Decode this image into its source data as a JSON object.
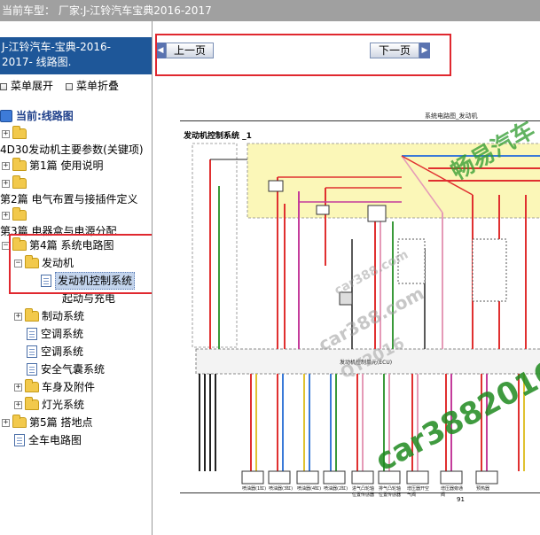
{
  "window": {
    "title": "当前车型：  厂家:J-江铃汽车宝典2016-2017"
  },
  "left_panel": {
    "header_line1": "J-江铃汽车-宝典-2016-",
    "header_line2": "2017- 线路图.",
    "expand_label": "菜单展开",
    "collapse_label": "菜单折叠",
    "current_label": "当前:线路图",
    "tree": [
      {
        "label": ""
      },
      {
        "label": "4D30发动机主要参数(关键项)"
      },
      {
        "label": "第1篇 使用说明"
      },
      {
        "label": ""
      },
      {
        "label": "第2篇 电气布置与接插件定义"
      },
      {
        "label": ""
      },
      {
        "label": "第3篇 电器盒与电源分配"
      },
      {
        "label": "第4篇 系统电路图"
      },
      {
        "label": "发动机"
      },
      {
        "label": "发动机控制系统"
      },
      {
        "label": "起动与充电"
      },
      {
        "label": "制动系统"
      },
      {
        "label": "空调系统"
      },
      {
        "label": "空调系统"
      },
      {
        "label": "安全气囊系统"
      },
      {
        "label": "车身及附件"
      },
      {
        "label": "灯光系统"
      },
      {
        "label": "第5篇 搭地点"
      },
      {
        "label": "全车电路图"
      }
    ]
  },
  "toolbar": {
    "prev_label": "上一页",
    "next_label": "下一页"
  },
  "diagram": {
    "header": "系统电路图_发动机",
    "section_title": "发动机控制系统 _1",
    "ecu_label": "发动机控制单元(ECU)",
    "page_number": "91",
    "bottom_labels": [
      "喷油器(1缸)",
      "喷油器(3缸)",
      "喷油器(4缸)",
      "喷油器(2缸)",
      "进气凸轮轴位置传感器",
      "排气凸轮轴位置传感器",
      "增压器开空气阀",
      "增压器旁通阀",
      "预热器"
    ],
    "watermarks": [
      "畅易汽车",
      "car388.com",
      "QY2016",
      "car388.com",
      "car3882016"
    ]
  },
  "colors": {
    "titlebar_bg": "#a0a0a0",
    "left_header_bg": "#1e5799",
    "highlight_box": "#e0282f",
    "watermark_green": "#1f8a1f"
  }
}
